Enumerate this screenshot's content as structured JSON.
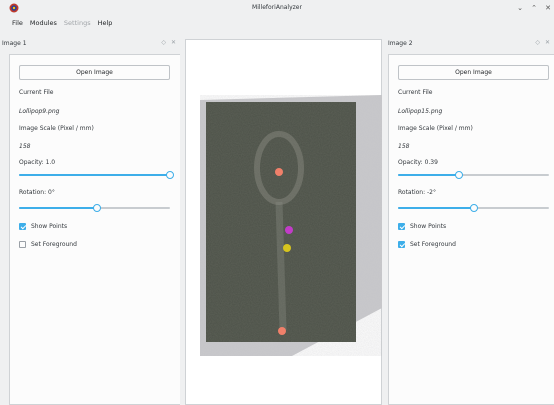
{
  "window": {
    "title": "MilleforiAnalyzer"
  },
  "menubar": {
    "items": [
      {
        "label": "File",
        "enabled": true
      },
      {
        "label": "Modules",
        "enabled": true
      },
      {
        "label": "Settings",
        "enabled": false
      },
      {
        "label": "Help",
        "enabled": true
      }
    ]
  },
  "image1": {
    "title": "Image 1",
    "open_label": "Open Image",
    "current_file_label": "Current File",
    "current_file": "Lollipop9.png",
    "scale_label": "Image Scale (Pixel / mm)",
    "scale_value": "158",
    "opacity_label": "Opacity: 1.0",
    "opacity_fraction": 1.0,
    "rotation_label": "Rotation: 0°",
    "rotation_fraction": 0.5,
    "show_points_label": "Show Points",
    "show_points": true,
    "set_foreground_label": "Set Foreground",
    "set_foreground": false
  },
  "image2": {
    "title": "Image 2",
    "open_label": "Open Image",
    "current_file_label": "Current File",
    "current_file": "Lollipop15.png",
    "scale_label": "Image Scale (Pixel / mm)",
    "scale_value": "158",
    "opacity_label": "Opacity: 0.39",
    "opacity_fraction": 0.39,
    "rotation_label": "Rotation: -2°",
    "rotation_fraction": 0.49,
    "show_points_label": "Show Points",
    "show_points": true,
    "set_foreground_label": "Set Foreground",
    "set_foreground": true
  },
  "colors": {
    "accent": "#3daee9",
    "point_salmon": "#f0806a",
    "point_magenta": "#c23cc8",
    "point_yellow": "#d6c41e"
  }
}
